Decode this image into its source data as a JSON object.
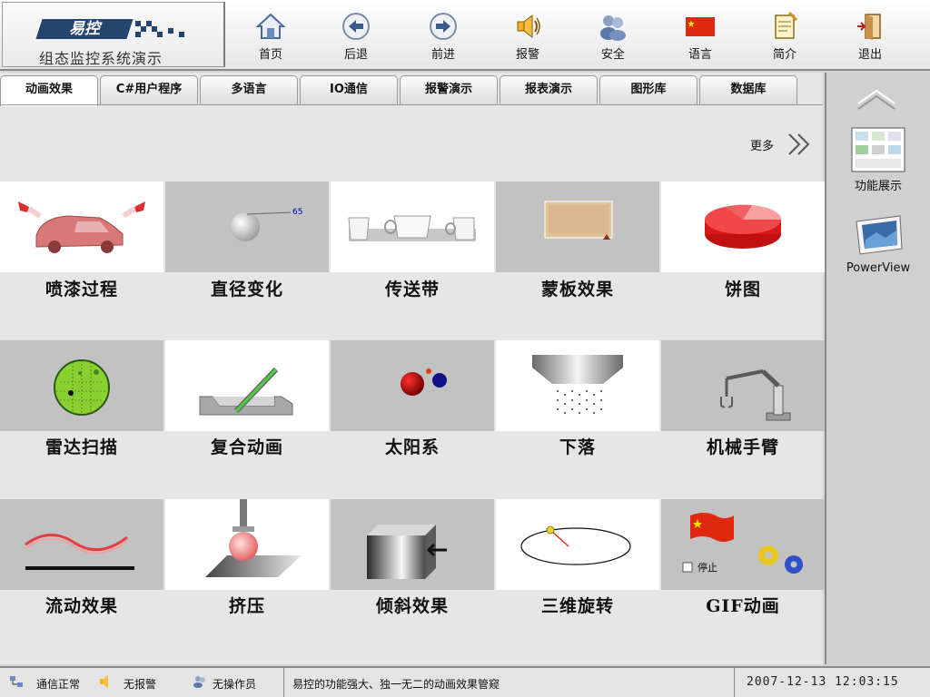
{
  "header": {
    "logo_badge": "易控",
    "logo_title": "组态监控系统演示",
    "nav": [
      {
        "label": "首页",
        "icon": "home-icon"
      },
      {
        "label": "后退",
        "icon": "back-icon"
      },
      {
        "label": "前进",
        "icon": "forward-icon"
      },
      {
        "label": "报警",
        "icon": "alarm-speaker-icon"
      },
      {
        "label": "安全",
        "icon": "users-icon"
      },
      {
        "label": "语言",
        "icon": "china-flag-icon"
      },
      {
        "label": "简介",
        "icon": "intro-icon"
      },
      {
        "label": "退出",
        "icon": "exit-door-icon"
      }
    ]
  },
  "tabs": [
    "动画效果",
    "C#用户程序",
    "多语言",
    "IO通信",
    "报警演示",
    "报表演示",
    "图形库",
    "数据库"
  ],
  "active_tab": "动画效果",
  "more_label": "更多",
  "tiles": [
    {
      "caption": "喷漆过程",
      "thumb": "car-spray-thumbnail"
    },
    {
      "caption": "直径变化",
      "thumb": "diameter-thumbnail",
      "value_label": "65"
    },
    {
      "caption": "传送带",
      "thumb": "conveyor-cups-thumbnail"
    },
    {
      "caption": "蒙板效果",
      "thumb": "mask-thumbnail"
    },
    {
      "caption": "饼图",
      "thumb": "pie-chart-thumbnail"
    },
    {
      "caption": "雷达扫描",
      "thumb": "radar-thumbnail"
    },
    {
      "caption": "复合动画",
      "thumb": "composite-animation-thumbnail"
    },
    {
      "caption": "太阳系",
      "thumb": "solar-system-thumbnail"
    },
    {
      "caption": "下落",
      "thumb": "falling-thumbnail"
    },
    {
      "caption": "机械手臂",
      "thumb": "robot-arm-thumbnail"
    },
    {
      "caption": "流动效果",
      "thumb": "flow-thumbnail"
    },
    {
      "caption": "挤压",
      "thumb": "squeeze-thumbnail"
    },
    {
      "caption": "倾斜效果",
      "thumb": "tilt-thumbnail"
    },
    {
      "caption": "三维旋转",
      "thumb": "rotation-3d-thumbnail"
    },
    {
      "caption": "GIF动画",
      "thumb": "gif-thumbnail",
      "checkbox_label": "停止"
    }
  ],
  "sidebar": {
    "items": [
      {
        "label": "功能展示",
        "icon": "feature-showcase-icon"
      },
      {
        "label": "PowerView",
        "icon": "powerview-icon"
      }
    ]
  },
  "status": {
    "comm": "通信正常",
    "alarm": "无报警",
    "operator": "无操作员",
    "message": "易控的功能强大、独一无二的动画效果管窥",
    "time": "2007-12-13  12:03:15"
  },
  "colors": {
    "header_bg": "#ffffff",
    "tile_gray": "#c2c2c2",
    "logo_blue": "#23446e",
    "accent_red": "#cc0000"
  }
}
